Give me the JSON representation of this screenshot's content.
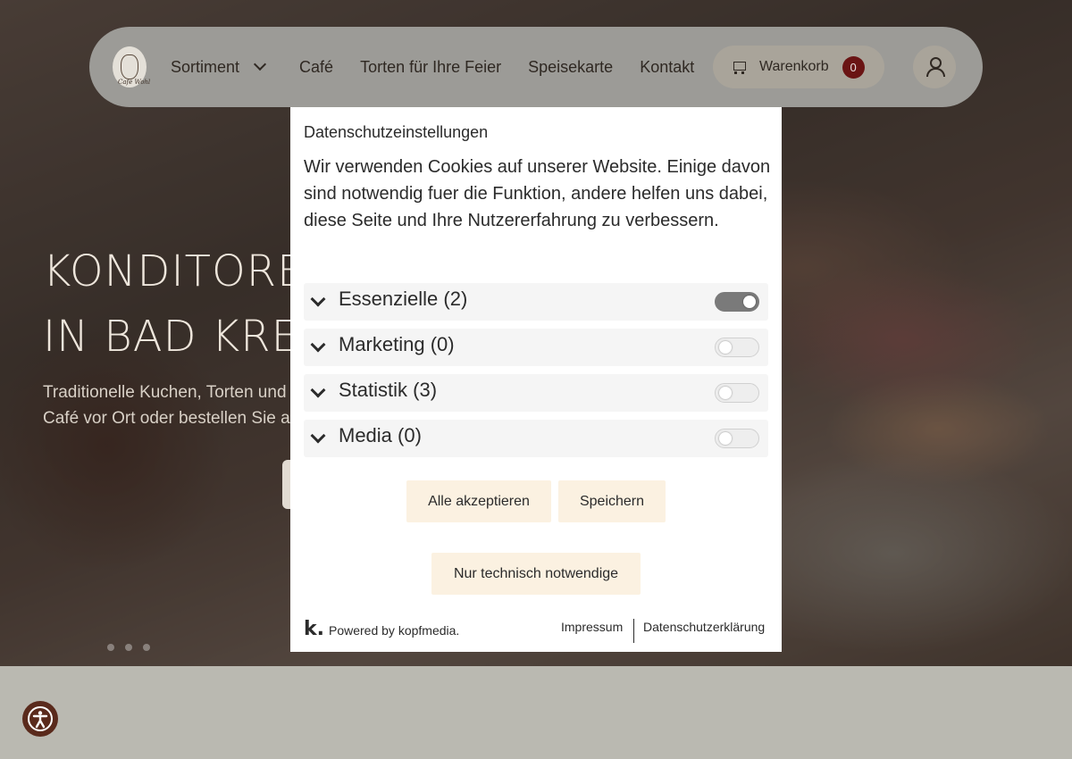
{
  "hero": {
    "title_line1": "KONDITORE",
    "title_line2": "IN BAD KREU",
    "sub_line1": "Traditionelle Kuchen, Torten und",
    "sub_line2": "Café vor Ort oder bestellen Sie au"
  },
  "header": {
    "logo_text": "Café Wohl",
    "nav": [
      {
        "label": "Sortiment",
        "has_dropdown": true
      },
      {
        "label": "Café"
      },
      {
        "label": "Torten für Ihre Feier"
      },
      {
        "label": "Speisekarte"
      },
      {
        "label": "Kontakt"
      }
    ],
    "cart": {
      "label": "Warenkorb",
      "count": "0",
      "icon": "cart-icon"
    },
    "account": {
      "icon": "user-icon"
    }
  },
  "modal": {
    "title": "Datenschutzeinstellungen",
    "text": "Wir verwenden Cookies auf unserer Website. Einige davon sind notwendig fuer die Funktion, andere helfen uns dabei, diese Seite und Ihre Nutzererfahrung zu verbessern.",
    "categories": [
      {
        "label": "Essenzielle (2)",
        "enabled": true
      },
      {
        "label": "Marketing (0)",
        "enabled": false
      },
      {
        "label": "Statistik (3)",
        "enabled": false
      },
      {
        "label": "Media (0)",
        "enabled": false
      }
    ],
    "buttons": {
      "accept_all": "Alle akzeptieren",
      "save": "Speichern",
      "essential_only": "Nur technisch notwendige"
    },
    "powered_logo": "k.",
    "powered_text": "Powered by kopfmedia.",
    "links": {
      "imprint": "Impressum",
      "privacy": "Datenschutzerklärung"
    }
  },
  "colors": {
    "badge": "#6a1414",
    "button_bg": "#fbf1e1",
    "a11y_button": "#5a2a1c"
  }
}
